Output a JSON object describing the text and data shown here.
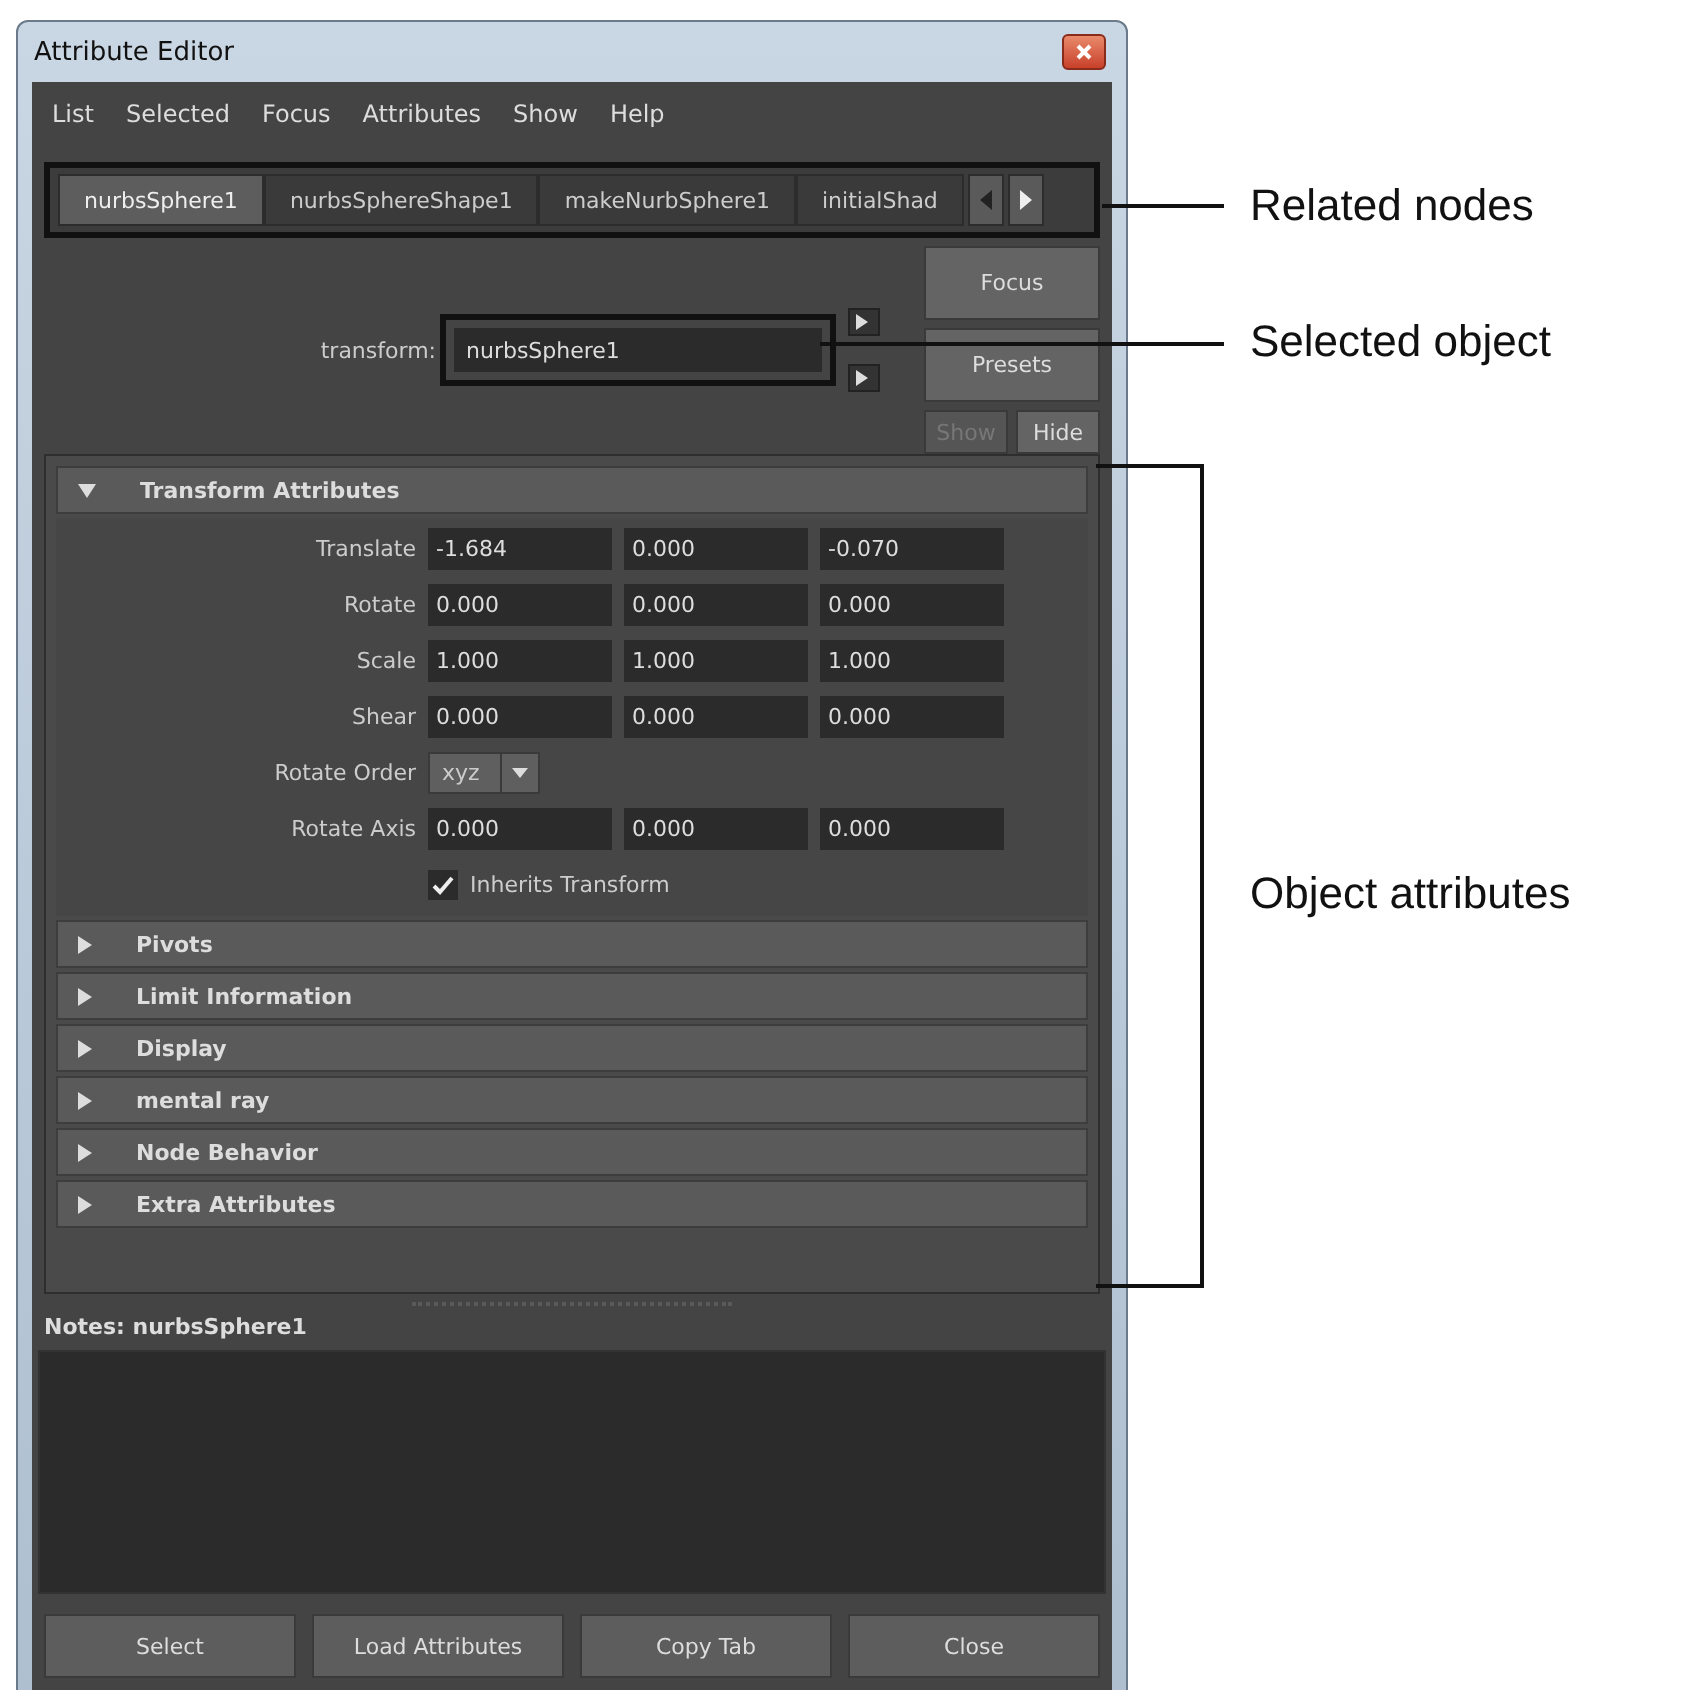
{
  "window": {
    "title": "Attribute Editor"
  },
  "menu": [
    "List",
    "Selected",
    "Focus",
    "Attributes",
    "Show",
    "Help"
  ],
  "tabs": [
    {
      "label": "nurbsSphere1",
      "selected": true
    },
    {
      "label": "nurbsSphereShape1",
      "selected": false
    },
    {
      "label": "makeNurbSphere1",
      "selected": false
    },
    {
      "label": "initialShad",
      "selected": false
    }
  ],
  "node": {
    "label": "transform:",
    "value": "nurbsSphere1"
  },
  "side_buttons": [
    {
      "label": "Focus",
      "disabled": false
    },
    {
      "label": "Presets",
      "disabled": false
    },
    {
      "label": "Show",
      "disabled": true
    },
    {
      "label": "Hide",
      "disabled": false
    }
  ],
  "sections": [
    {
      "title": "Transform Attributes",
      "expanded": true,
      "rows": [
        {
          "kind": "vector",
          "label": "Translate",
          "values": [
            "-1.684",
            "0.000",
            "-0.070"
          ]
        },
        {
          "kind": "vector",
          "label": "Rotate",
          "values": [
            "0.000",
            "0.000",
            "0.000"
          ]
        },
        {
          "kind": "vector",
          "label": "Scale",
          "values": [
            "1.000",
            "1.000",
            "1.000"
          ]
        },
        {
          "kind": "vector",
          "label": "Shear",
          "values": [
            "0.000",
            "0.000",
            "0.000"
          ]
        },
        {
          "kind": "dropdown",
          "label": "Rotate Order",
          "value": "xyz"
        },
        {
          "kind": "vector",
          "label": "Rotate Axis",
          "values": [
            "0.000",
            "0.000",
            "0.000"
          ]
        },
        {
          "kind": "checkbox",
          "label": "Inherits Transform",
          "checked": true
        }
      ]
    },
    {
      "title": "Pivots",
      "expanded": false
    },
    {
      "title": "Limit Information",
      "expanded": false
    },
    {
      "title": "Display",
      "expanded": false
    },
    {
      "title": "mental ray",
      "expanded": false
    },
    {
      "title": "Node Behavior",
      "expanded": false
    },
    {
      "title": "Extra Attributes",
      "expanded": false
    }
  ],
  "notes": {
    "label": "Notes:  nurbsSphere1"
  },
  "buttons": [
    "Select",
    "Load Attributes",
    "Copy Tab",
    "Close"
  ],
  "callouts": [
    {
      "text": "Related nodes"
    },
    {
      "text": "Selected object"
    },
    {
      "text": "Object attributes"
    }
  ]
}
